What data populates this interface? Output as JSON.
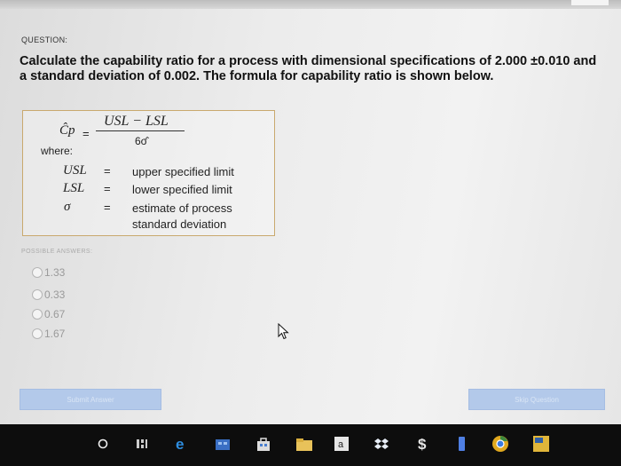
{
  "question": {
    "label": "QUESTION:",
    "text": "Calculate the capability ratio for a process with dimensional specifications of 2.000 ±0.010 and a standard deviation of 0.002. The formula for capability ratio is shown below."
  },
  "formula": {
    "lhs": "Ĉp",
    "eq": "=",
    "numerator": "USL − LSL",
    "denominator": "6σ̂",
    "where": "where:",
    "definitions": [
      {
        "sym": "USL",
        "eq": "=",
        "desc": "upper specified limit"
      },
      {
        "sym": "LSL",
        "eq": "=",
        "desc": "lower specified limit"
      },
      {
        "sym": "σ",
        "eq": "=",
        "desc": "estimate of process",
        "desc2": "standard deviation"
      }
    ]
  },
  "answers": {
    "label": "POSSIBLE ANSWERS:",
    "options": [
      "1.33",
      "0.33",
      "0.67",
      "1.67"
    ]
  },
  "buttons": {
    "submit": "Submit Answer",
    "skip": "Skip Question"
  },
  "taskbar": {
    "icons": [
      "cortana-circle-icon",
      "task-view-icon",
      "edge-icon",
      "store-icon",
      "store-bag-icon",
      "explorer-icon",
      "amazon-icon",
      "dropbox-icon",
      "money-icon",
      "app-icon",
      "chrome-icon",
      "winword-icon"
    ]
  },
  "colors": {
    "button": "#b3c9ea",
    "box_border": "#c9a96e"
  }
}
